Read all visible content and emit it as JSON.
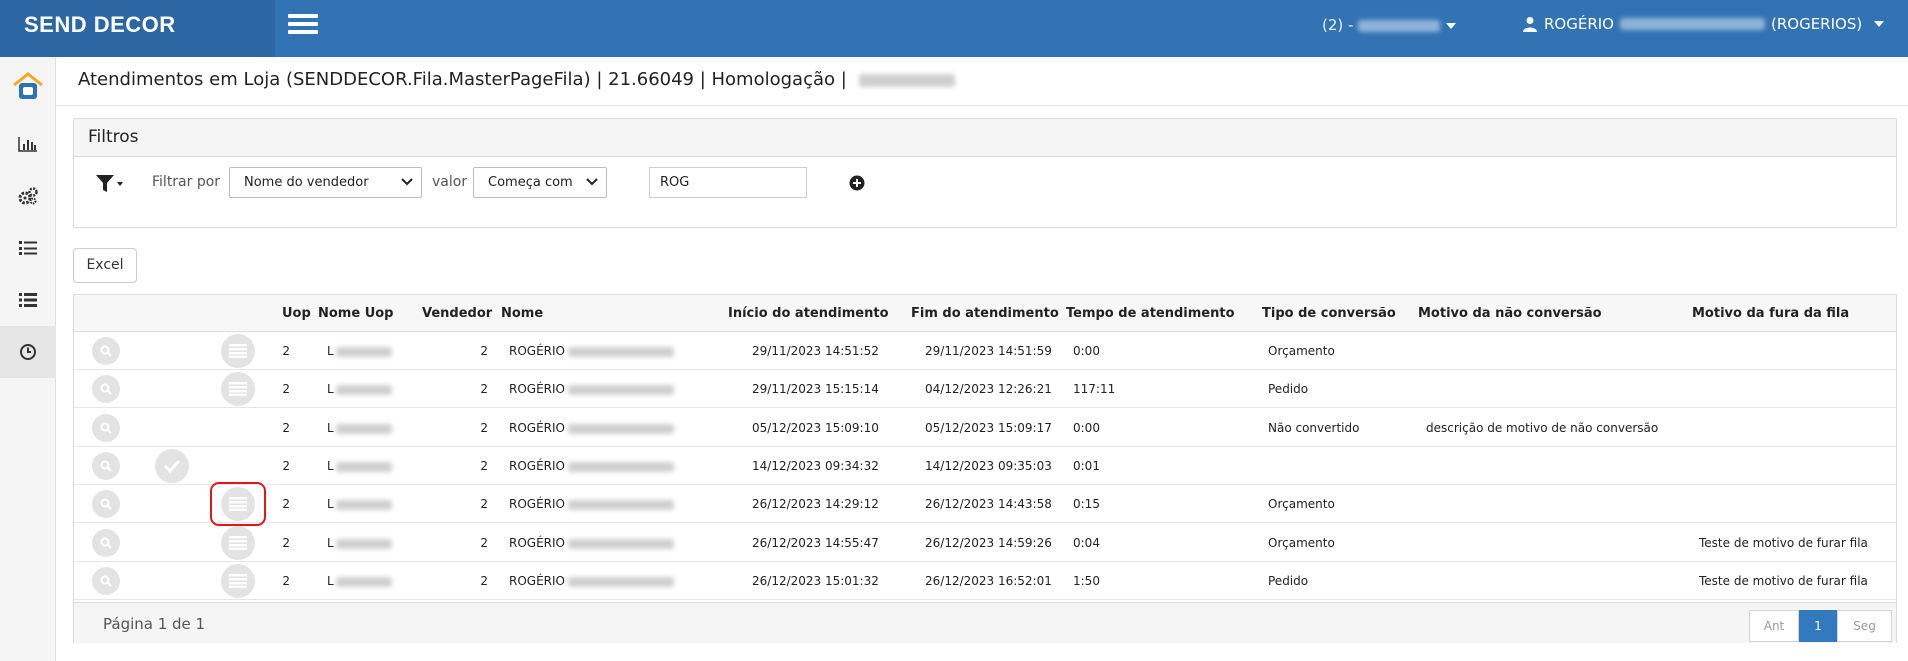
{
  "brand": "SEND DECOR",
  "header": {
    "store_prefix": "(2) - ",
    "user_first": "ROGÉRIO",
    "user_login": "(ROGERIOS)"
  },
  "sidebar": {
    "items": [
      "logo-icon",
      "bar-chart-icon",
      "gears-icon",
      "list-ordered-icon",
      "list-icon",
      "clock-icon"
    ]
  },
  "page_title": "Atendimentos em Loja (SENDDECOR.Fila.MasterPageFila) | 21.66049 | Homologação |",
  "filters": {
    "title": "Filtros",
    "filter_by_label": "Filtrar por",
    "filter_by_value": "Nome do vendedor",
    "value_label": "valor",
    "operator_value": "Começa com",
    "text_value": "ROG"
  },
  "excel_label": "Excel",
  "table": {
    "headers": {
      "uop": "Uop",
      "nome_uop": "Nome Uop",
      "vendedor": "Vendedor",
      "nome": "Nome",
      "inicio": "Início do atendimento",
      "fim": "Fim do atendimento",
      "tempo": "Tempo de atendimento",
      "tipo": "Tipo de conversão",
      "motivo_nao": "Motivo da não conversão",
      "motivo_fura": "Motivo da fura da fila"
    },
    "rows": [
      {
        "uop": "2",
        "nome_uop": "L",
        "vendedor": "2",
        "nome": "ROGÉRIO",
        "inicio": "29/11/2023 14:51:52",
        "fim": "29/11/2023 14:51:59",
        "tempo": "0:00",
        "tipo": "Orçamento",
        "motivo_nao": "",
        "motivo_fura": "",
        "action": "doc"
      },
      {
        "uop": "2",
        "nome_uop": "L",
        "vendedor": "2",
        "nome": "ROGÉRIO",
        "inicio": "29/11/2023 15:15:14",
        "fim": "04/12/2023 12:26:21",
        "tempo": "117:11",
        "tipo": "Pedido",
        "motivo_nao": "",
        "motivo_fura": "",
        "action": "doc"
      },
      {
        "uop": "2",
        "nome_uop": "L",
        "vendedor": "2",
        "nome": "ROGÉRIO",
        "inicio": "05/12/2023 15:09:10",
        "fim": "05/12/2023 15:09:17",
        "tempo": "0:00",
        "tipo": "Não convertido",
        "motivo_nao": "descrição de motivo de não conversão",
        "motivo_fura": "",
        "action": "none"
      },
      {
        "uop": "2",
        "nome_uop": "L",
        "vendedor": "2",
        "nome": "ROGÉRIO",
        "inicio": "14/12/2023 09:34:32",
        "fim": "14/12/2023 09:35:03",
        "tempo": "0:01",
        "tipo": "",
        "motivo_nao": "",
        "motivo_fura": "",
        "action": "check"
      },
      {
        "uop": "2",
        "nome_uop": "L",
        "vendedor": "2",
        "nome": "ROGÉRIO",
        "inicio": "26/12/2023 14:29:12",
        "fim": "26/12/2023 14:43:58",
        "tempo": "0:15",
        "tipo": "Orçamento",
        "motivo_nao": "",
        "motivo_fura": "",
        "action": "doc-highlight"
      },
      {
        "uop": "2",
        "nome_uop": "L",
        "vendedor": "2",
        "nome": "ROGÉRIO",
        "inicio": "26/12/2023 14:55:47",
        "fim": "26/12/2023 14:59:26",
        "tempo": "0:04",
        "tipo": "Orçamento",
        "motivo_nao": "",
        "motivo_fura": "Teste de motivo de furar fila",
        "action": "doc"
      },
      {
        "uop": "2",
        "nome_uop": "L",
        "vendedor": "2",
        "nome": "ROGÉRIO",
        "inicio": "26/12/2023 15:01:32",
        "fim": "26/12/2023 16:52:01",
        "tempo": "1:50",
        "tipo": "Pedido",
        "motivo_nao": "",
        "motivo_fura": "Teste de motivo de furar fila",
        "action": "doc"
      }
    ]
  },
  "pagination": {
    "info": "Página 1 de 1",
    "prev": "Ant",
    "current": "1",
    "next": "Seg"
  },
  "colors": {
    "topbar": "#3273b4",
    "brand_bg": "#2c67a3",
    "highlight": "#e0161b",
    "pager_active": "#3279be"
  }
}
